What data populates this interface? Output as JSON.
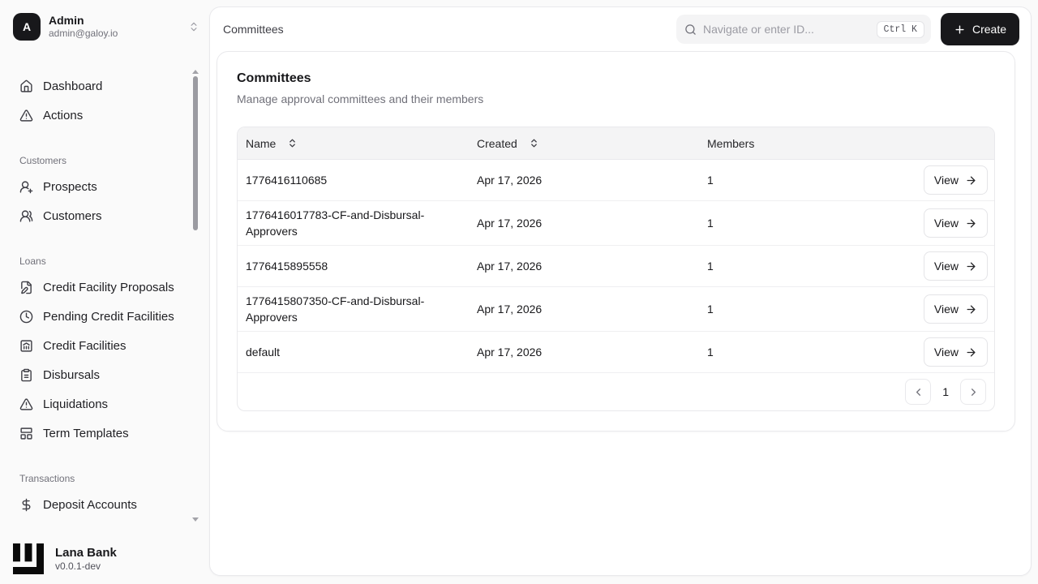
{
  "sidebar": {
    "user": {
      "initial": "A",
      "name": "Admin",
      "email": "admin@galoy.io"
    },
    "sections": [
      {
        "label": "",
        "items": [
          {
            "label": "Dashboard"
          },
          {
            "label": "Actions"
          }
        ]
      },
      {
        "label": "Customers",
        "items": [
          {
            "label": "Prospects"
          },
          {
            "label": "Customers"
          }
        ]
      },
      {
        "label": "Loans",
        "items": [
          {
            "label": "Credit Facility Proposals"
          },
          {
            "label": "Pending Credit Facilities"
          },
          {
            "label": "Credit Facilities"
          },
          {
            "label": "Disbursals"
          },
          {
            "label": "Liquidations"
          },
          {
            "label": "Term Templates"
          }
        ]
      },
      {
        "label": "Transactions",
        "items": [
          {
            "label": "Deposit Accounts"
          }
        ]
      }
    ],
    "brand": {
      "name": "Lana Bank",
      "version": "v0.0.1-dev"
    }
  },
  "header": {
    "breadcrumb": "Committees",
    "search_placeholder": "Navigate or enter ID...",
    "shortcut": "Ctrl K",
    "create_label": "Create"
  },
  "page": {
    "title": "Committees",
    "description": "Manage approval committees and their members"
  },
  "table": {
    "columns": {
      "name": "Name",
      "created": "Created",
      "members": "Members"
    },
    "rows": [
      {
        "name": "1776416110685",
        "created": "Apr 17, 2026",
        "members": "1",
        "action": "View"
      },
      {
        "name": "1776416017783-CF-and-Disbursal-Approvers",
        "created": "Apr 17, 2026",
        "members": "1",
        "action": "View"
      },
      {
        "name": "1776415895558",
        "created": "Apr 17, 2026",
        "members": "1",
        "action": "View"
      },
      {
        "name": "1776415807350-CF-and-Disbursal-Approvers",
        "created": "Apr 17, 2026",
        "members": "1",
        "action": "View"
      },
      {
        "name": "default",
        "created": "Apr 17, 2026",
        "members": "1",
        "action": "View"
      }
    ],
    "pagination": {
      "current": "1"
    }
  },
  "colors": {
    "background": "#fafafa",
    "surface": "#ffffff",
    "accent": "#18181b",
    "muted_text": "#71717a",
    "border": "#e4e4e7",
    "table_header_bg": "#f4f4f5"
  }
}
